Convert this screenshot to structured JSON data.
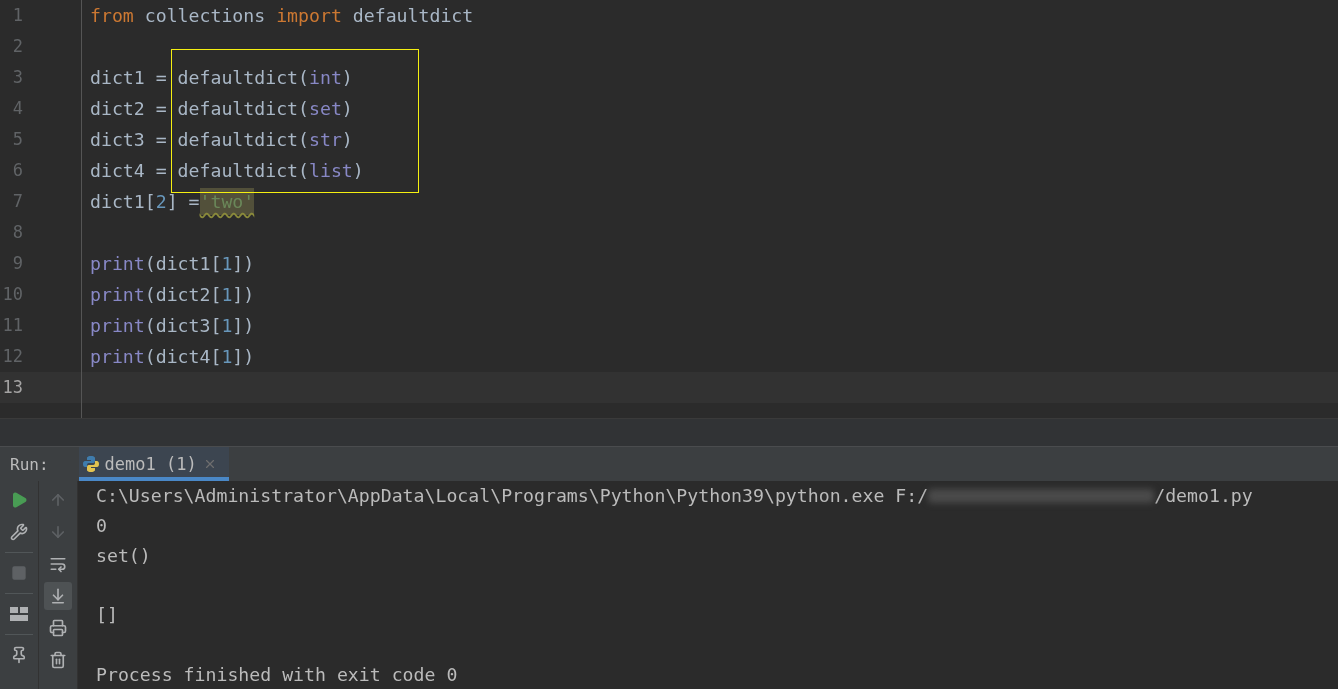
{
  "editor": {
    "lines": [
      {
        "number": "1",
        "current": false,
        "boxed": false,
        "tokens": [
          {
            "text": "from",
            "kind": "keyword"
          },
          {
            "text": " collections ",
            "kind": "plain"
          },
          {
            "text": "import",
            "kind": "keyword"
          },
          {
            "text": " defaultdict",
            "kind": "plain"
          }
        ]
      },
      {
        "number": "2",
        "current": false,
        "boxed": false
      },
      {
        "number": "3",
        "current": false,
        "boxed": true,
        "tokens": [
          {
            "text": "dict1 = defaultdict(",
            "kind": "plain"
          },
          {
            "text": "int",
            "kind": "builtin"
          },
          {
            "text": ")",
            "kind": "plain"
          }
        ]
      },
      {
        "number": "4",
        "current": false,
        "boxed": true,
        "tokens": [
          {
            "text": "dict2 = defaultdict(",
            "kind": "plain"
          },
          {
            "text": "set",
            "kind": "builtin"
          },
          {
            "text": ")",
            "kind": "plain"
          }
        ]
      },
      {
        "number": "5",
        "current": false,
        "boxed": true,
        "tokens": [
          {
            "text": "dict3 = defaultdict(",
            "kind": "plain"
          },
          {
            "text": "str",
            "kind": "builtin"
          },
          {
            "text": ")",
            "kind": "plain"
          }
        ]
      },
      {
        "number": "6",
        "current": false,
        "boxed": true,
        "tokens": [
          {
            "text": "dict4 = defaultdict(",
            "kind": "plain"
          },
          {
            "text": "list",
            "kind": "builtin"
          },
          {
            "text": ")",
            "kind": "plain"
          }
        ]
      },
      {
        "number": "7",
        "current": false,
        "boxed": false,
        "tokens": [
          {
            "text": "dict1[",
            "kind": "plain"
          },
          {
            "text": "2",
            "kind": "number"
          },
          {
            "text": "] =",
            "kind": "plain"
          },
          {
            "text": "'two'",
            "kind": "flagged_string"
          }
        ]
      },
      {
        "number": "8",
        "current": false,
        "boxed": false
      },
      {
        "number": "9",
        "current": false,
        "boxed": false,
        "tokens": [
          {
            "text": "print",
            "kind": "builtin"
          },
          {
            "text": "(dict1[",
            "kind": "plain"
          },
          {
            "text": "1",
            "kind": "number"
          },
          {
            "text": "])",
            "kind": "plain"
          }
        ]
      },
      {
        "number": "10",
        "current": false,
        "boxed": false,
        "tokens": [
          {
            "text": "print",
            "kind": "builtin"
          },
          {
            "text": "(dict2[",
            "kind": "plain"
          },
          {
            "text": "1",
            "kind": "number"
          },
          {
            "text": "])",
            "kind": "plain"
          }
        ]
      },
      {
        "number": "11",
        "current": false,
        "boxed": false,
        "tokens": [
          {
            "text": "print",
            "kind": "builtin"
          },
          {
            "text": "(dict3[",
            "kind": "plain"
          },
          {
            "text": "1",
            "kind": "number"
          },
          {
            "text": "])",
            "kind": "plain"
          }
        ]
      },
      {
        "number": "12",
        "current": false,
        "boxed": false,
        "tokens": [
          {
            "text": "print",
            "kind": "builtin"
          },
          {
            "text": "(dict4[",
            "kind": "plain"
          },
          {
            "text": "1",
            "kind": "number"
          },
          {
            "text": "])",
            "kind": "plain"
          }
        ]
      },
      {
        "number": "13",
        "current": true,
        "boxed": false
      }
    ]
  },
  "run_panel": {
    "label": "Run:",
    "tabs": [
      {
        "label": "demo1 (1)",
        "selected": true
      }
    ],
    "left_toolbar": [
      {
        "kind": "run",
        "disabled": false
      },
      {
        "kind": "wrench",
        "disabled": false
      },
      {
        "kind": "separator"
      },
      {
        "kind": "stop",
        "disabled": true
      },
      {
        "kind": "separator"
      },
      {
        "kind": "layout",
        "disabled": false
      },
      {
        "kind": "separator"
      },
      {
        "kind": "pin",
        "disabled": false
      }
    ],
    "right_toolbar": [
      {
        "kind": "up",
        "disabled": true,
        "selected": false
      },
      {
        "kind": "down",
        "disabled": true,
        "selected": false
      },
      {
        "kind": "wrap",
        "disabled": false,
        "selected": false
      },
      {
        "kind": "scroll_end",
        "disabled": false,
        "selected": true
      },
      {
        "kind": "print",
        "disabled": false,
        "selected": false
      },
      {
        "kind": "trash",
        "disabled": false,
        "selected": false
      }
    ],
    "console": [
      {
        "kind": "output",
        "parts": [
          {
            "kind": "text",
            "text": "C:\\Users\\Administrator\\AppData\\Local\\Programs\\Python\\Python39\\python.exe F:/"
          },
          {
            "kind": "redacted"
          },
          {
            "kind": "text",
            "text": "/demo1.py"
          }
        ]
      },
      {
        "kind": "output",
        "parts": [
          {
            "kind": "text",
            "text": "0"
          }
        ]
      },
      {
        "kind": "output",
        "parts": [
          {
            "kind": "text",
            "text": "set()"
          }
        ]
      },
      {
        "kind": "blank"
      },
      {
        "kind": "output",
        "parts": [
          {
            "kind": "text",
            "text": "[]"
          }
        ]
      },
      {
        "kind": "blank"
      },
      {
        "kind": "output",
        "parts": [
          {
            "kind": "text",
            "text": "Process finished with exit code 0"
          }
        ]
      }
    ]
  }
}
